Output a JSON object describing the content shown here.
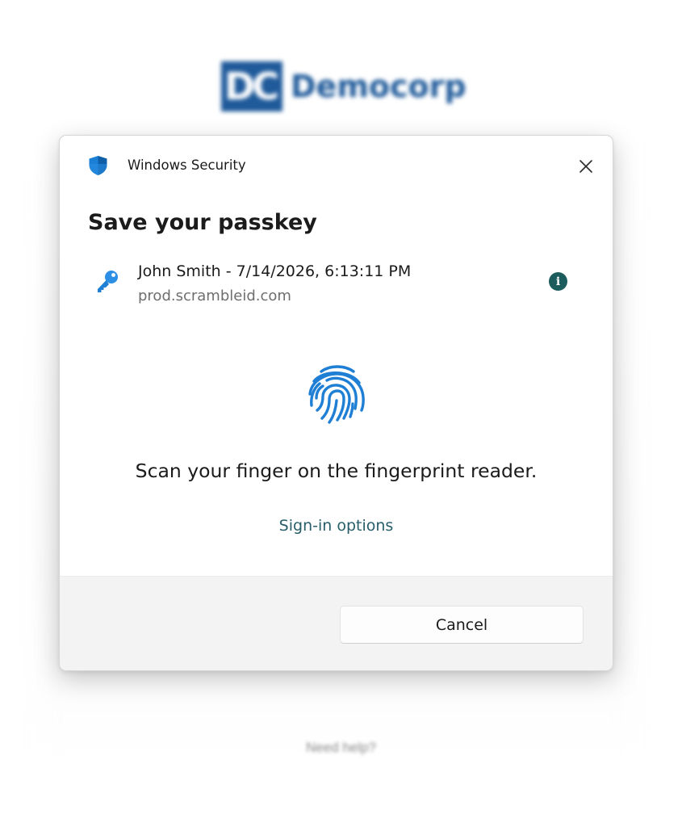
{
  "background": {
    "logo_mark": "DC",
    "logo_name": "Democorp",
    "help_link": "Need help?"
  },
  "dialog": {
    "app_title": "Windows Security",
    "heading": "Save your passkey",
    "account": {
      "name": "John Smith - 7/14/2026, 6:13:11 PM",
      "domain": "prod.scrambleid.com"
    },
    "prompt": "Scan your finger on the fingerprint reader.",
    "signin_options_label": "Sign-in options",
    "cancel_label": "Cancel",
    "icons": {
      "title": "shield-icon",
      "account": "key-icon",
      "info": "info-icon",
      "biometric": "fingerprint-icon",
      "close": "close-icon"
    },
    "colors": {
      "accent_blue": "#1f7fd4",
      "link_teal": "#275e6a",
      "info_badge": "#1d5c5c",
      "footer_bg": "#f3f3f3"
    }
  }
}
